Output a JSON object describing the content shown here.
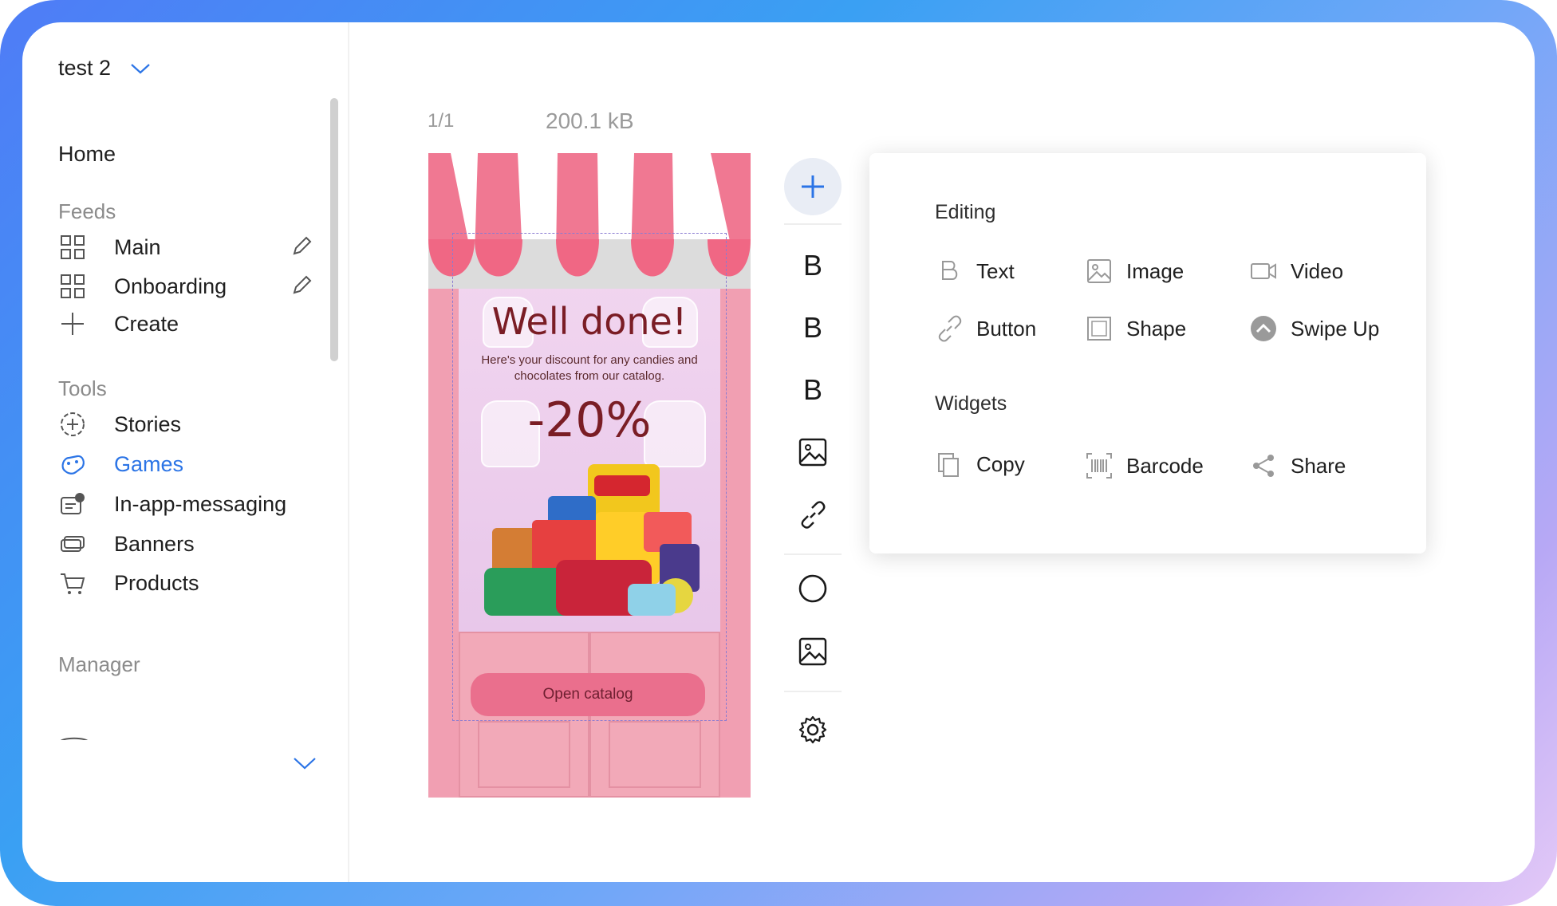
{
  "project": {
    "name": "test 2"
  },
  "sidebar": {
    "home": "Home",
    "feeds_title": "Feeds",
    "feeds": [
      {
        "label": "Main"
      },
      {
        "label": "Onboarding"
      },
      {
        "label": "Create"
      }
    ],
    "tools_title": "Tools",
    "tools": [
      {
        "label": "Stories"
      },
      {
        "label": "Games"
      },
      {
        "label": "In-app-messaging"
      },
      {
        "label": "Banners"
      },
      {
        "label": "Products"
      }
    ],
    "manager_title": "Manager"
  },
  "canvas": {
    "page_counter": "1/1",
    "file_size": "200.1 kB"
  },
  "story": {
    "title": "Well done!",
    "subtitle": "Here's your discount for any candies and chocolates from our catalog.",
    "discount": "-20%",
    "button": "Open catalog"
  },
  "toolbar": {
    "items": [
      "add",
      "text-1",
      "text-2",
      "text-3",
      "image",
      "link",
      "circle",
      "image-2",
      "settings"
    ],
    "text_glyph": "B"
  },
  "panel": {
    "editing_title": "Editing",
    "editing": [
      {
        "label": "Text",
        "icon": "text-icon"
      },
      {
        "label": "Image",
        "icon": "image-icon"
      },
      {
        "label": "Video",
        "icon": "video-icon"
      },
      {
        "label": "Button",
        "icon": "link-icon"
      },
      {
        "label": "Shape",
        "icon": "shape-icon"
      },
      {
        "label": "Swipe Up",
        "icon": "swipe-up-icon"
      }
    ],
    "widgets_title": "Widgets",
    "widgets": [
      {
        "label": "Copy",
        "icon": "copy-icon"
      },
      {
        "label": "Barcode",
        "icon": "barcode-icon"
      },
      {
        "label": "Share",
        "icon": "share-icon"
      }
    ]
  },
  "colors": {
    "accent": "#2b74e6",
    "story_bg": "#f2a5b5",
    "story_text": "#7a1d25",
    "button_bg": "#ea6f8d"
  }
}
